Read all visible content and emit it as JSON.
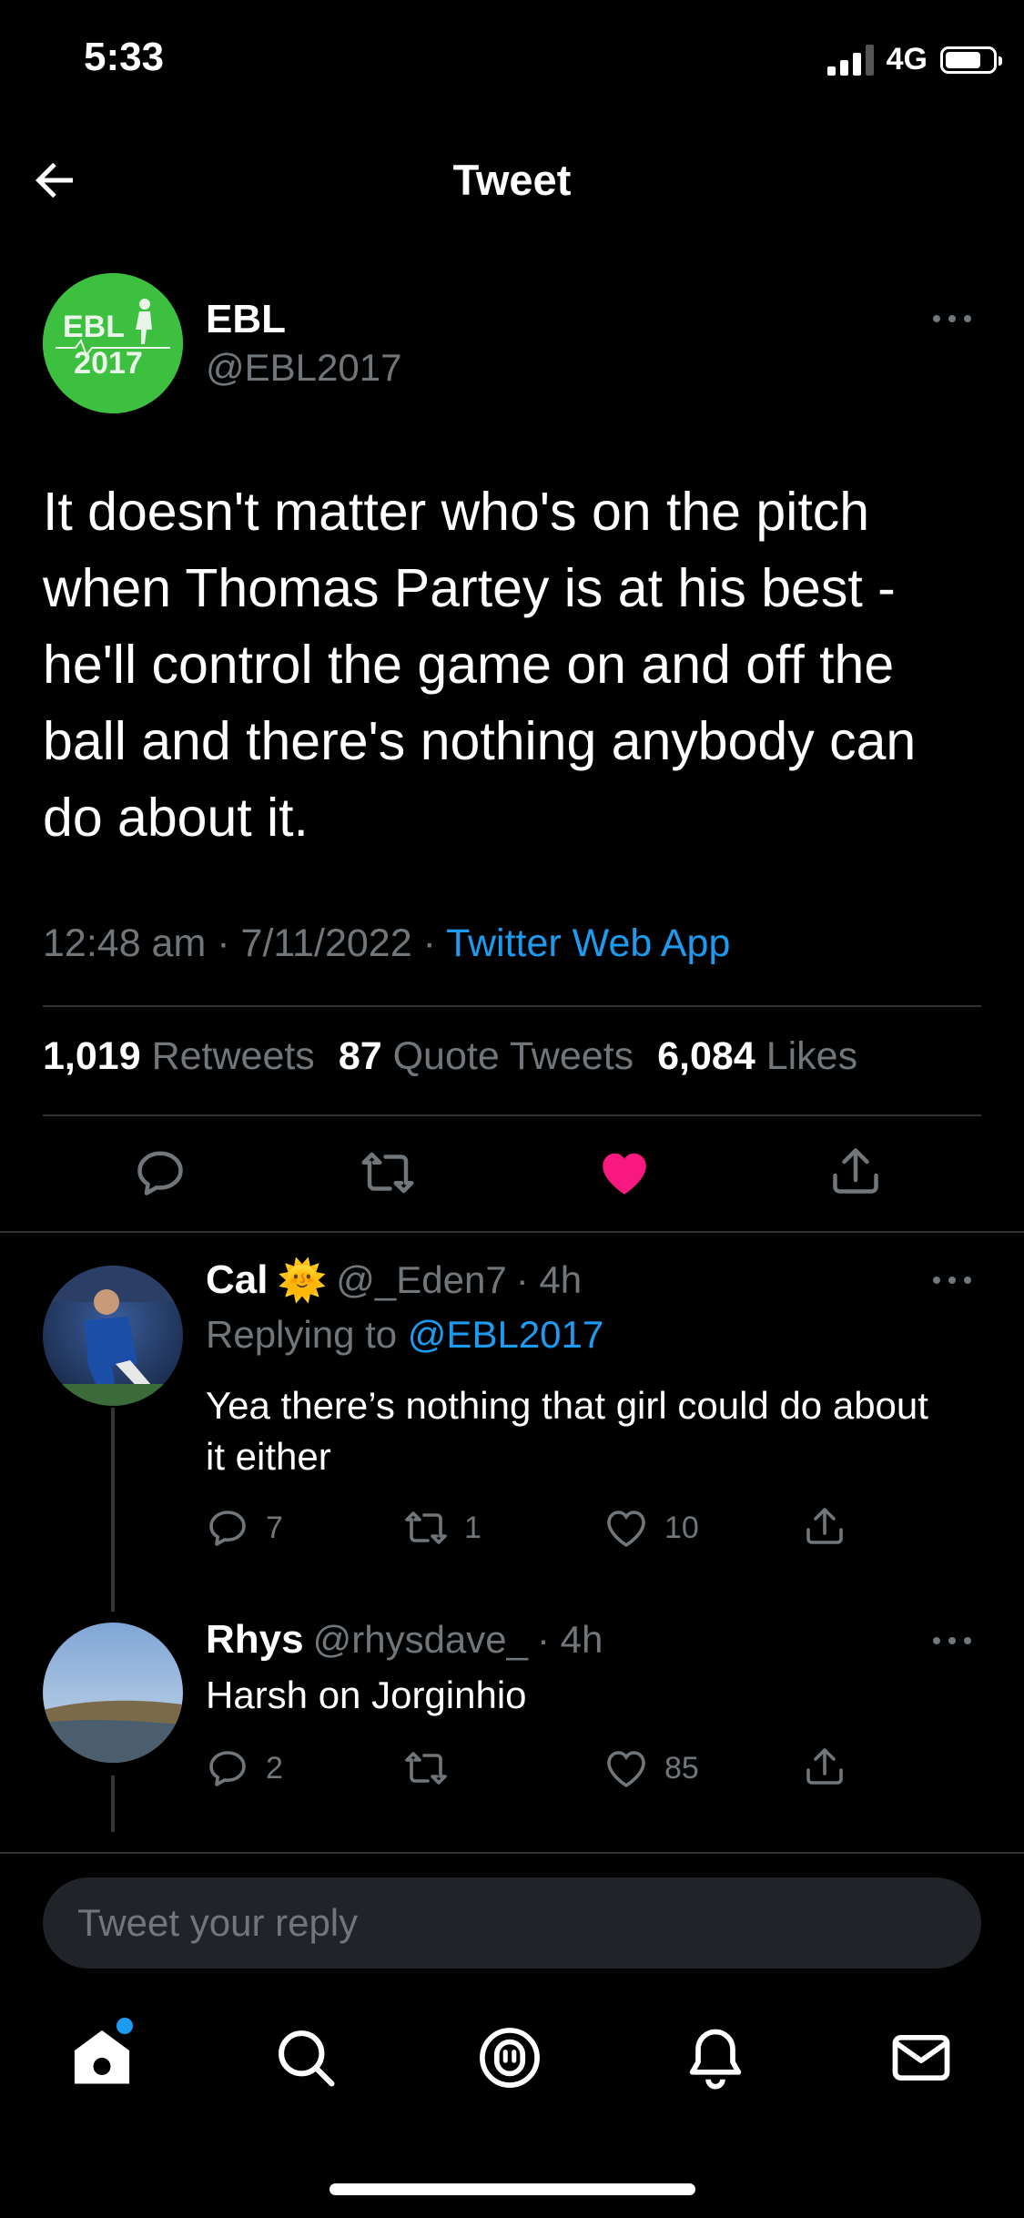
{
  "status_bar": {
    "time": "5:33",
    "network": "4G"
  },
  "header": {
    "title": "Tweet"
  },
  "tweet": {
    "author_name": "EBL",
    "author_handle": "@EBL2017",
    "avatar_text_top": "EBL",
    "avatar_text_bottom": "2017",
    "text": "It doesn't matter who's on the pitch when Thomas Partey is at his best - he'll control the game on and off the ball and there's nothing anybody can do about it.",
    "time": "12:48 am",
    "date": "7/11/2022",
    "sep": "·",
    "source": "Twitter Web App",
    "retweets_count": "1,019",
    "retweets_label": "Retweets",
    "quotes_count": "87",
    "quotes_label": "Quote Tweets",
    "likes_count": "6,084",
    "likes_label": "Likes",
    "liked": true
  },
  "replies": [
    {
      "name": "Cal",
      "emoji": "🌞",
      "handle": "@_Eden7",
      "age": "· 4h",
      "replying_prefix": "Replying to",
      "replying_handle": "@EBL2017",
      "text": "Yea there’s nothing that girl could do about it either",
      "replies": "7",
      "retweets": "1",
      "likes": "10"
    },
    {
      "name": "Rhys",
      "handle": "@rhysdave_",
      "age": "· 4h",
      "text": "Harsh on Jorginhio",
      "replies": "2",
      "retweets": "",
      "likes": "85"
    }
  ],
  "reply_input": {
    "placeholder": "Tweet your reply"
  },
  "colors": {
    "accent": "#1d9bf0",
    "like": "#f91880",
    "avatar_green": "#3dbf3f"
  },
  "icons": [
    "back-arrow-icon",
    "more-icon",
    "reply-icon",
    "retweet-icon",
    "heart-icon",
    "share-icon",
    "home-icon",
    "search-icon",
    "spaces-icon",
    "notifications-icon",
    "messages-icon"
  ]
}
